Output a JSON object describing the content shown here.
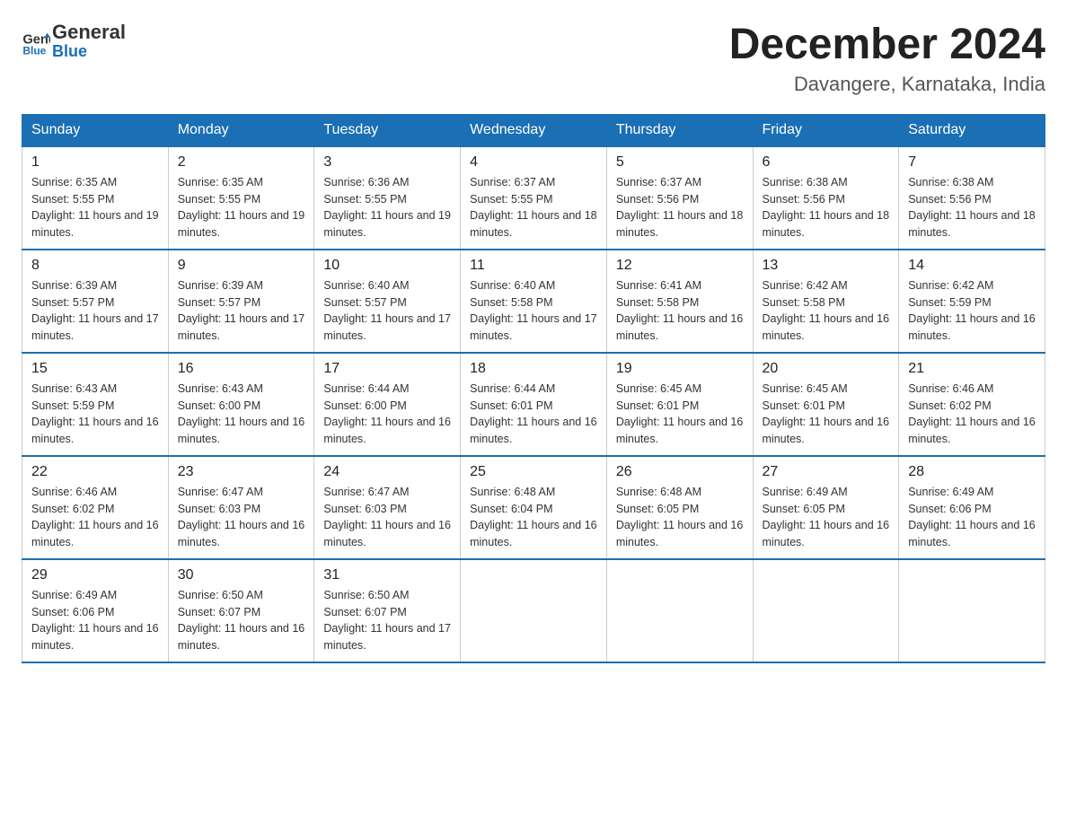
{
  "header": {
    "logo_text_black": "General",
    "logo_text_blue": "Blue",
    "month_title": "December 2024",
    "location": "Davangere, Karnataka, India"
  },
  "weekdays": [
    "Sunday",
    "Monday",
    "Tuesday",
    "Wednesday",
    "Thursday",
    "Friday",
    "Saturday"
  ],
  "weeks": [
    [
      {
        "day": "1",
        "sunrise": "6:35 AM",
        "sunset": "5:55 PM",
        "daylight": "11 hours and 19 minutes."
      },
      {
        "day": "2",
        "sunrise": "6:35 AM",
        "sunset": "5:55 PM",
        "daylight": "11 hours and 19 minutes."
      },
      {
        "day": "3",
        "sunrise": "6:36 AM",
        "sunset": "5:55 PM",
        "daylight": "11 hours and 19 minutes."
      },
      {
        "day": "4",
        "sunrise": "6:37 AM",
        "sunset": "5:55 PM",
        "daylight": "11 hours and 18 minutes."
      },
      {
        "day": "5",
        "sunrise": "6:37 AM",
        "sunset": "5:56 PM",
        "daylight": "11 hours and 18 minutes."
      },
      {
        "day": "6",
        "sunrise": "6:38 AM",
        "sunset": "5:56 PM",
        "daylight": "11 hours and 18 minutes."
      },
      {
        "day": "7",
        "sunrise": "6:38 AM",
        "sunset": "5:56 PM",
        "daylight": "11 hours and 18 minutes."
      }
    ],
    [
      {
        "day": "8",
        "sunrise": "6:39 AM",
        "sunset": "5:57 PM",
        "daylight": "11 hours and 17 minutes."
      },
      {
        "day": "9",
        "sunrise": "6:39 AM",
        "sunset": "5:57 PM",
        "daylight": "11 hours and 17 minutes."
      },
      {
        "day": "10",
        "sunrise": "6:40 AM",
        "sunset": "5:57 PM",
        "daylight": "11 hours and 17 minutes."
      },
      {
        "day": "11",
        "sunrise": "6:40 AM",
        "sunset": "5:58 PM",
        "daylight": "11 hours and 17 minutes."
      },
      {
        "day": "12",
        "sunrise": "6:41 AM",
        "sunset": "5:58 PM",
        "daylight": "11 hours and 16 minutes."
      },
      {
        "day": "13",
        "sunrise": "6:42 AM",
        "sunset": "5:58 PM",
        "daylight": "11 hours and 16 minutes."
      },
      {
        "day": "14",
        "sunrise": "6:42 AM",
        "sunset": "5:59 PM",
        "daylight": "11 hours and 16 minutes."
      }
    ],
    [
      {
        "day": "15",
        "sunrise": "6:43 AM",
        "sunset": "5:59 PM",
        "daylight": "11 hours and 16 minutes."
      },
      {
        "day": "16",
        "sunrise": "6:43 AM",
        "sunset": "6:00 PM",
        "daylight": "11 hours and 16 minutes."
      },
      {
        "day": "17",
        "sunrise": "6:44 AM",
        "sunset": "6:00 PM",
        "daylight": "11 hours and 16 minutes."
      },
      {
        "day": "18",
        "sunrise": "6:44 AM",
        "sunset": "6:01 PM",
        "daylight": "11 hours and 16 minutes."
      },
      {
        "day": "19",
        "sunrise": "6:45 AM",
        "sunset": "6:01 PM",
        "daylight": "11 hours and 16 minutes."
      },
      {
        "day": "20",
        "sunrise": "6:45 AM",
        "sunset": "6:01 PM",
        "daylight": "11 hours and 16 minutes."
      },
      {
        "day": "21",
        "sunrise": "6:46 AM",
        "sunset": "6:02 PM",
        "daylight": "11 hours and 16 minutes."
      }
    ],
    [
      {
        "day": "22",
        "sunrise": "6:46 AM",
        "sunset": "6:02 PM",
        "daylight": "11 hours and 16 minutes."
      },
      {
        "day": "23",
        "sunrise": "6:47 AM",
        "sunset": "6:03 PM",
        "daylight": "11 hours and 16 minutes."
      },
      {
        "day": "24",
        "sunrise": "6:47 AM",
        "sunset": "6:03 PM",
        "daylight": "11 hours and 16 minutes."
      },
      {
        "day": "25",
        "sunrise": "6:48 AM",
        "sunset": "6:04 PM",
        "daylight": "11 hours and 16 minutes."
      },
      {
        "day": "26",
        "sunrise": "6:48 AM",
        "sunset": "6:05 PM",
        "daylight": "11 hours and 16 minutes."
      },
      {
        "day": "27",
        "sunrise": "6:49 AM",
        "sunset": "6:05 PM",
        "daylight": "11 hours and 16 minutes."
      },
      {
        "day": "28",
        "sunrise": "6:49 AM",
        "sunset": "6:06 PM",
        "daylight": "11 hours and 16 minutes."
      }
    ],
    [
      {
        "day": "29",
        "sunrise": "6:49 AM",
        "sunset": "6:06 PM",
        "daylight": "11 hours and 16 minutes."
      },
      {
        "day": "30",
        "sunrise": "6:50 AM",
        "sunset": "6:07 PM",
        "daylight": "11 hours and 16 minutes."
      },
      {
        "day": "31",
        "sunrise": "6:50 AM",
        "sunset": "6:07 PM",
        "daylight": "11 hours and 17 minutes."
      },
      null,
      null,
      null,
      null
    ]
  ]
}
